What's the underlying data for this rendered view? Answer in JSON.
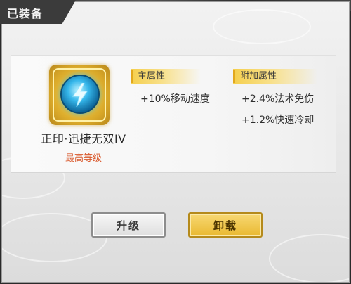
{
  "header": {
    "title": "已装备"
  },
  "item": {
    "icon": "lightning-orb-emblem-icon",
    "name": "正印·迅捷无双IV",
    "level_status": "最高等级"
  },
  "attributes": {
    "main": {
      "heading": "主属性",
      "values": [
        "+10%移动速度"
      ]
    },
    "extra": {
      "heading": "附加属性",
      "values": [
        "+2.4%法术免伤",
        "+1.2%快速冷却"
      ]
    }
  },
  "actions": {
    "upgrade_label": "升级",
    "unequip_label": "卸载"
  },
  "colors": {
    "accent_gold": "#e9b931",
    "level_text": "#d9572a",
    "header_bg": "#3b3b3b"
  }
}
